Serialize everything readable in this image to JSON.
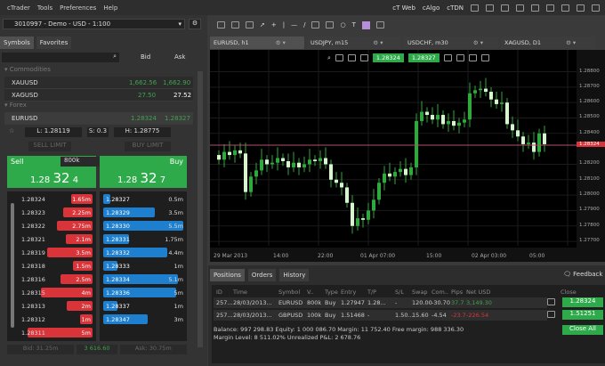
{
  "menu": {
    "items": [
      "cTrader",
      "Tools",
      "Preferences",
      "Help"
    ],
    "links": [
      "cT Web",
      "cAlgo",
      "cTDN"
    ]
  },
  "account": {
    "label": "3010997 - Demo - USD - 1:100"
  },
  "left_tabs": [
    "Symbols",
    "Favorites"
  ],
  "watch": {
    "bid_label": "Bid",
    "ask_label": "Ask",
    "group_commodities": "▾ Commodities",
    "group_forex": "▾ Forex",
    "rows": [
      {
        "symbol": "XAUUSD",
        "bid": "1,662.56",
        "ask": "1,662.90"
      },
      {
        "symbol": "XAGUSD",
        "bid": "27.50",
        "ask": "27.52"
      },
      {
        "symbol": "EURUSD",
        "bid": "1.28324",
        "ask": "1.28327"
      }
    ]
  },
  "ticket": {
    "low": "L: 1.28119",
    "spread": "S: 0.3",
    "high": "H: 1.28775",
    "sell_limit": "SELL LIMIT",
    "buy_limit": "BUY LIMIT",
    "sell": "Sell",
    "buy": "Buy",
    "volume": "800k",
    "sell_price": {
      "a": "1.28",
      "b": "32",
      "c": "4"
    },
    "buy_price": {
      "a": "1.28",
      "b": "32",
      "c": "7"
    }
  },
  "depth": {
    "bids": [
      [
        "1.28324",
        "1.65m",
        0.3
      ],
      [
        "1.28323",
        "2.25m",
        0.41
      ],
      [
        "1.28322",
        "2.75m",
        0.5
      ],
      [
        "1.28321",
        "2.1m",
        0.38
      ],
      [
        "1.28319",
        "3.5m",
        0.64
      ],
      [
        "1.28318",
        "1.5m",
        0.27
      ],
      [
        "1.28316",
        "2.5m",
        0.45
      ],
      [
        "1.28315",
        "4m",
        0.73
      ],
      [
        "1.28313",
        "2m",
        0.36
      ],
      [
        "1.28312",
        "1m",
        0.18
      ],
      [
        "1.28311",
        "5m",
        0.91
      ]
    ],
    "asks": [
      [
        "1.28327",
        "0.5m",
        0.09
      ],
      [
        "1.28329",
        "3.5m",
        0.64
      ],
      [
        "1.28330",
        "5.5m",
        1.0
      ],
      [
        "1.28331",
        "1.75m",
        0.32
      ],
      [
        "1.28332",
        "4.4m",
        0.8
      ],
      [
        "1.28333",
        "1m",
        0.18
      ],
      [
        "1.28334",
        "5.1m",
        0.93
      ],
      [
        "1.28336",
        "5m",
        0.91
      ],
      [
        "1.28337",
        "1m",
        0.18
      ],
      [
        "1.28347",
        "3m",
        0.55
      ]
    ],
    "footer": {
      "bid": "Bid: 31.25m",
      "mid": "3 616.60",
      "ask": "Ask: 30.75m"
    }
  },
  "chart_tabs": [
    "EURUSD, h1",
    "USDJPY, m15",
    "USDCHF, m30",
    "XAGUSD, D1"
  ],
  "quick": {
    "sell": "1.28324",
    "buy": "1.28327"
  },
  "chart_data": {
    "type": "candlestick",
    "symbol": "EURUSD",
    "timeframe": "h1",
    "x_ticks": [
      "29 Mar 2013",
      "14:00",
      "22:00",
      "01 Apr 07:00",
      "15:00",
      "02 Apr 03:00",
      "05:00"
    ],
    "y_ticks": [
      "1.28800",
      "1.28700",
      "1.28600",
      "1.28500",
      "1.28400",
      "1.28200",
      "1.28100",
      "1.28000",
      "1.27900",
      "1.27800",
      "1.27700"
    ],
    "ylim": [
      1.2766,
      1.2893
    ],
    "current_price": "1.28324",
    "current_value": 1.28324,
    "closes": [
      1.2823,
      1.2828,
      1.2826,
      1.2829,
      1.2827,
      1.2802,
      1.2812,
      1.2816,
      1.2823,
      1.282,
      1.2821,
      1.2824,
      1.2822,
      1.2818,
      1.2821,
      1.2818,
      1.282,
      1.2823,
      1.2822,
      1.2824,
      1.282,
      1.281,
      1.2808,
      1.2805,
      1.2795,
      1.278,
      1.2785,
      1.2784,
      1.279,
      1.2797,
      1.2808,
      1.2814,
      1.2812,
      1.2815,
      1.2817,
      1.2813,
      1.2818,
      1.2848,
      1.2854,
      1.2852,
      1.2849,
      1.2852,
      1.2846,
      1.2848,
      1.2845,
      1.2847,
      1.2849,
      1.2866,
      1.2868,
      1.2869,
      1.2867,
      1.2862,
      1.2859,
      1.286,
      1.2846,
      1.2842,
      1.2838,
      1.2833,
      1.2834,
      1.2828,
      1.284,
      1.2833
    ]
  },
  "bottom": {
    "tabs": [
      "Positions",
      "Orders",
      "History"
    ],
    "feedback": "Feedback",
    "columns": [
      "ID",
      "Time",
      "Symbol",
      "V..",
      "Type",
      "Entry",
      "T/P",
      "S/L",
      "Swap",
      "Com..",
      "Pips",
      "Net USD",
      "Close"
    ],
    "rows": [
      [
        "257...",
        "28/03/2013...",
        "EURUSD",
        "800k",
        "Buy",
        "1.27947",
        "1.28...",
        "-",
        "120.00",
        "-30.70",
        "37.7",
        "3,149.30",
        "1.28324"
      ],
      [
        "257...",
        "28/03/2013...",
        "GBPUSD",
        "100k",
        "Buy",
        "1.51468",
        "-",
        "1.50...",
        "15.60",
        "-4.54",
        "-23.7",
        "-226.54",
        "1.51251"
      ]
    ],
    "summary1": "Balance: 997 298.83   Equity: 1 000 086.70   Margin: 11 752.40   Free margin: 988 336.30",
    "summary2": "Margin Level: 8 511.02%   Unrealized P&L: 2 678.76",
    "close_all": "Close All"
  },
  "colors": {
    "green": "#2faa4a",
    "red": "#d9343a",
    "blue": "#1f7fcf",
    "candle_up": "#2fa83c",
    "candle_down": "#d8f5d0",
    "price_line": "#b0506a"
  }
}
